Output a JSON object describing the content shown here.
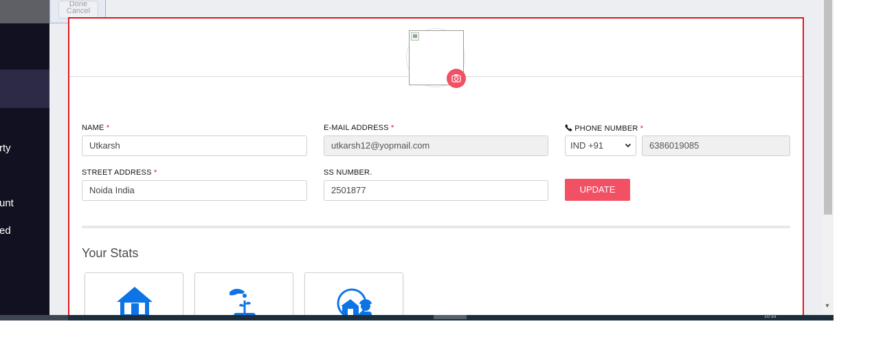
{
  "sidebar": {
    "items": [
      {
        "label": "rty"
      },
      {
        "label": "unt"
      },
      {
        "label": "ed"
      }
    ]
  },
  "popup": {
    "partial_label": "Done",
    "cancel_label": "Cancel"
  },
  "profile": {
    "fields": {
      "name": {
        "label": "NAME",
        "required": "*",
        "value": "Utkarsh"
      },
      "email": {
        "label": "E-MAIL ADDRESS",
        "required": "*",
        "value": "utkarsh12@yopmail.com"
      },
      "phone": {
        "label": "PHONE NUMBER",
        "required": "*",
        "country_code": "IND +91",
        "value": "6386019085"
      },
      "street": {
        "label": "STREET ADDRESS",
        "required": "*",
        "value": "Noida India"
      },
      "ss_number": {
        "label": "SS NUMBER.",
        "value": "2501877"
      }
    },
    "update_label": "UPDATE"
  },
  "stats": {
    "title": "Your Stats",
    "cards": [
      {
        "icon": "house-icon"
      },
      {
        "icon": "plant-hand-icon"
      },
      {
        "icon": "house-worker-icon"
      }
    ]
  },
  "taskbar": {
    "clock": "10:33"
  },
  "colors": {
    "accent": "#f25064",
    "sidebar_bg": "#121122",
    "icon_blue": "#0d74e6",
    "card_border": "#e0141d"
  }
}
